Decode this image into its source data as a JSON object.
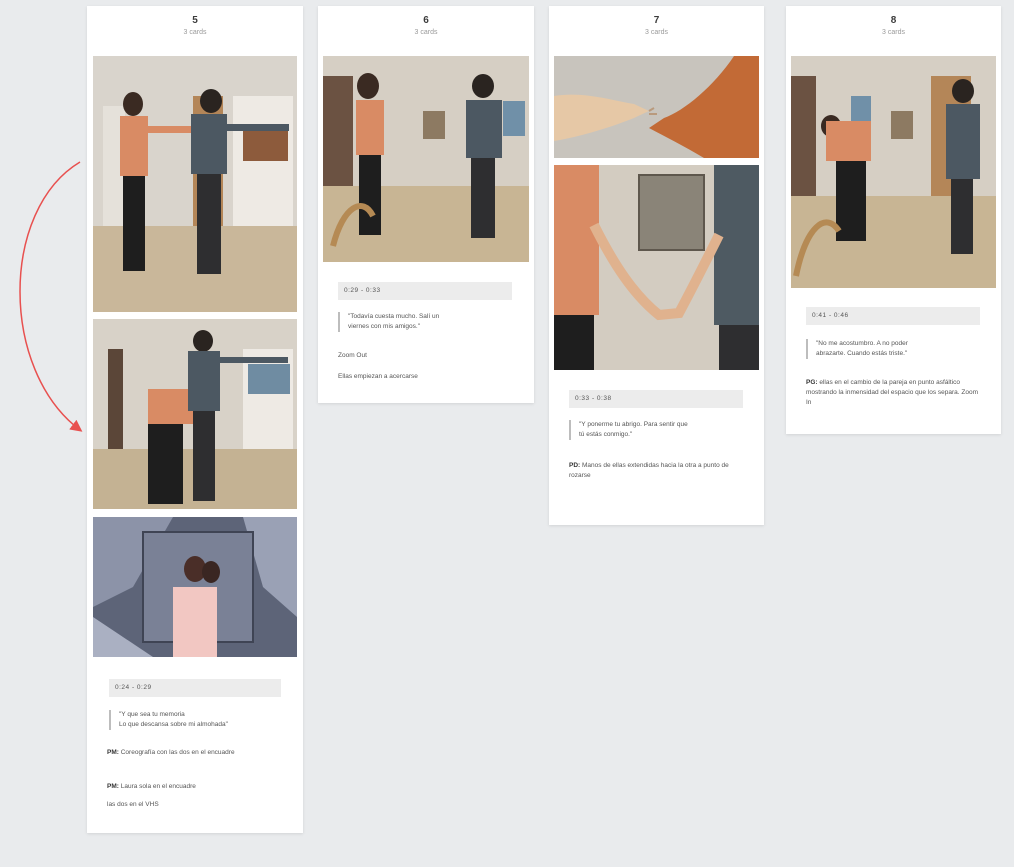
{
  "colors": {
    "background": "#e9ebed",
    "card": "#ffffff",
    "arrow": "#e8504f",
    "timecode_bg": "#ececec"
  },
  "cards": [
    {
      "number": "5",
      "subtitle": "3 cards",
      "timecode": "0:24 - 0:29",
      "quote": [
        "\"Y que sea tu memoria",
        "Lo que descansa sobre mi almohada\""
      ],
      "notes": [
        {
          "tag": "PM:",
          "text": "Coreografía con las dos en el encuadre"
        },
        {
          "tag": "PM:",
          "text": "Laura sola en el encuadre"
        },
        {
          "tag": "",
          "text": "las dos en el VHS"
        }
      ]
    },
    {
      "number": "6",
      "subtitle": "3 cards",
      "timecode": "0:29 - 0:33",
      "quote": [
        "\"Todavía cuesta mucho. Salí un",
        "viernes con mis amigos.\""
      ],
      "notes": [
        {
          "tag": "",
          "text": "Zoom Out"
        },
        {
          "tag": "",
          "text": "Ellas empiezan a acercarse"
        }
      ]
    },
    {
      "number": "7",
      "subtitle": "3 cards",
      "timecode": "0:33 - 0:38",
      "quote": [
        "\"Y ponerme tu abrigo. Para sentir que",
        "tú estás conmigo.\""
      ],
      "notes": [
        {
          "tag": "PD:",
          "text": "Manos de ellas extendidas hacia la otra a punto de rozarse"
        }
      ]
    },
    {
      "number": "8",
      "subtitle": "3 cards",
      "timecode": "0:41 - 0:46",
      "quote": [
        "\"No me acostumbro. A no poder",
        "abrazarte. Cuando estás triste.\""
      ],
      "notes": [
        {
          "tag": "PG:",
          "text": "ellas en el cambio de la pareja en punto asfáltico mostrando la inmensidad del espacio que los separa. Zoom In"
        }
      ]
    }
  ]
}
